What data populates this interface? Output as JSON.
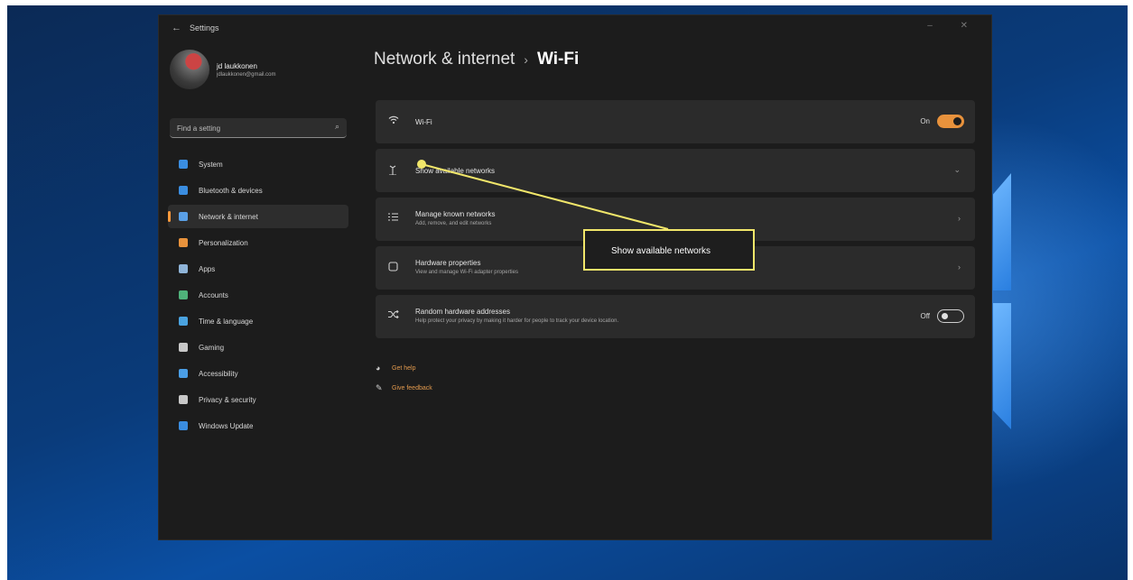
{
  "window": {
    "title": "Settings",
    "back_glyph": "←",
    "controls": "– ✕"
  },
  "profile": {
    "name": "jd laukkonen",
    "email": "jdlaukkonen@gmail.com"
  },
  "search": {
    "placeholder": "Find a setting"
  },
  "nav": {
    "items": [
      {
        "label": "System",
        "icon": "monitor-icon",
        "color": "#3a8de0",
        "active": false
      },
      {
        "label": "Bluetooth & devices",
        "icon": "bluetooth-icon",
        "color": "#3a8de0",
        "active": false
      },
      {
        "label": "Network & internet",
        "icon": "wifi-icon",
        "color": "#5aa0e6",
        "active": true
      },
      {
        "label": "Personalization",
        "icon": "brush-icon",
        "color": "#e8923c",
        "active": false
      },
      {
        "label": "Apps",
        "icon": "apps-icon",
        "color": "#8fb4d8",
        "active": false
      },
      {
        "label": "Accounts",
        "icon": "person-icon",
        "color": "#4fb27a",
        "active": false
      },
      {
        "label": "Time & language",
        "icon": "globe-icon",
        "color": "#4aa3e0",
        "active": false
      },
      {
        "label": "Gaming",
        "icon": "gamepad-icon",
        "color": "#c8c8c8",
        "active": false
      },
      {
        "label": "Accessibility",
        "icon": "accessibility-icon",
        "color": "#4a9ee6",
        "active": false
      },
      {
        "label": "Privacy & security",
        "icon": "shield-icon",
        "color": "#c8c8c8",
        "active": false
      },
      {
        "label": "Windows Update",
        "icon": "update-icon",
        "color": "#3a8de0",
        "active": false
      }
    ]
  },
  "heading": {
    "parent": "Network & internet",
    "separator": "›",
    "current": "Wi-Fi"
  },
  "cards": {
    "wifi": {
      "title": "Wi-Fi",
      "toggle_label": "On",
      "state": "on",
      "icon": "wifi-icon"
    },
    "show_networks": {
      "title": "Show available networks",
      "icon": "antenna-icon"
    },
    "manage_known": {
      "title": "Manage known networks",
      "desc": "Add, remove, and edit networks",
      "icon": "list-icon"
    },
    "hardware": {
      "title": "Hardware properties",
      "desc": "View and manage Wi-Fi adapter properties",
      "icon": "chip-icon"
    },
    "random_hw": {
      "title": "Random hardware addresses",
      "desc": "Help protect your privacy by making it harder for people to track your device location.",
      "toggle_label": "Off",
      "state": "off",
      "icon": "shuffle-icon"
    }
  },
  "links": {
    "help": "Get help",
    "feedback": "Give feedback"
  },
  "callout": {
    "text": "Show available networks",
    "color": "#f1e66a"
  },
  "colors": {
    "accent": "#e8923c",
    "window_bg": "#1c1c1c",
    "card_bg": "#2b2b2b"
  }
}
